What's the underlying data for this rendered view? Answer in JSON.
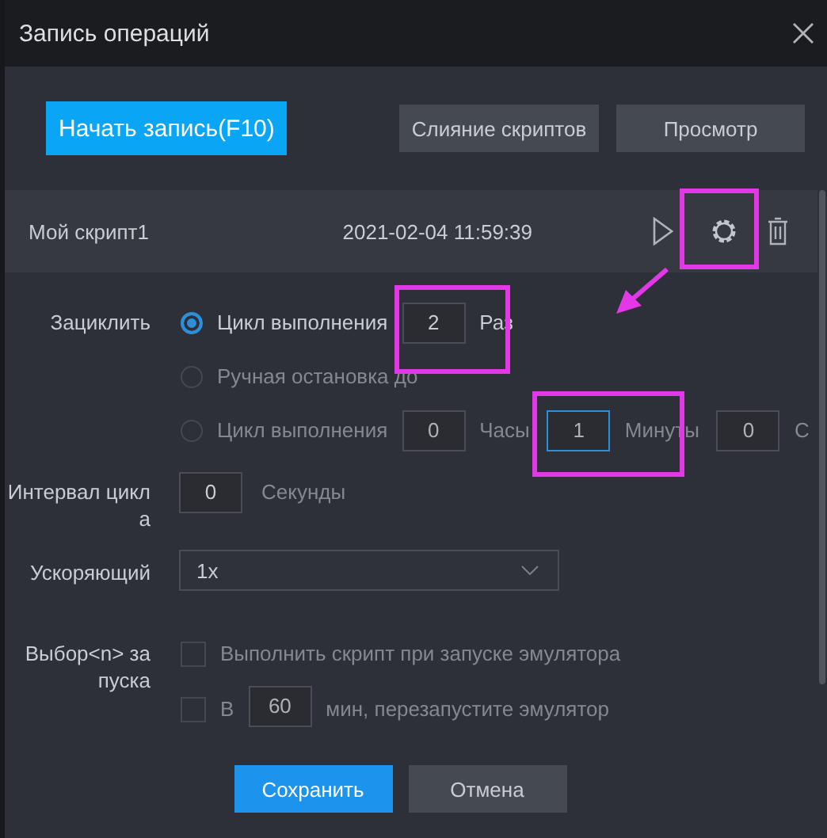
{
  "window": {
    "title": "Запись операций"
  },
  "toolbar": {
    "record_button": "Начать запись(F10)",
    "buttons": [
      "Слияние скриптов",
      "Просмотр"
    ]
  },
  "scripts": [
    {
      "name": "Мой скрипт1",
      "date": "2021-02-04 11:59:39"
    }
  ],
  "settings": {
    "loop": {
      "label": "Зациклить",
      "options": [
        {
          "kind": "count",
          "selected": true,
          "label": "Цикл выполнения",
          "value": "2",
          "unit": "Раз"
        },
        {
          "kind": "manual",
          "selected": false,
          "label": "Ручная остановка до"
        },
        {
          "kind": "time",
          "selected": false,
          "label": "Цикл выполнения",
          "fields": [
            {
              "value": "0",
              "unit": "Часы",
              "focused": false
            },
            {
              "value": "1",
              "unit": "Минуты",
              "focused": true
            },
            {
              "value": "0",
              "unit": "С",
              "focused": false
            }
          ]
        }
      ]
    },
    "interval": {
      "label": "Интервал цикла",
      "value": "0",
      "unit": "Секунды"
    },
    "speed": {
      "label": "Ускоряющий",
      "value": "1x"
    },
    "startup": {
      "label": "Выбор<n> за пуска",
      "options": [
        {
          "kind": "run",
          "checked": false,
          "label": "Выполнить скрипт при запуске эмулятора"
        },
        {
          "kind": "restart",
          "checked": false,
          "prefix": "В",
          "value": "60",
          "suffix": "мин, перезапустите эмулятор"
        }
      ]
    }
  },
  "actions": [
    {
      "label": "Сохранить",
      "primary": true
    },
    {
      "label": "Отмена",
      "primary": false
    }
  ]
}
